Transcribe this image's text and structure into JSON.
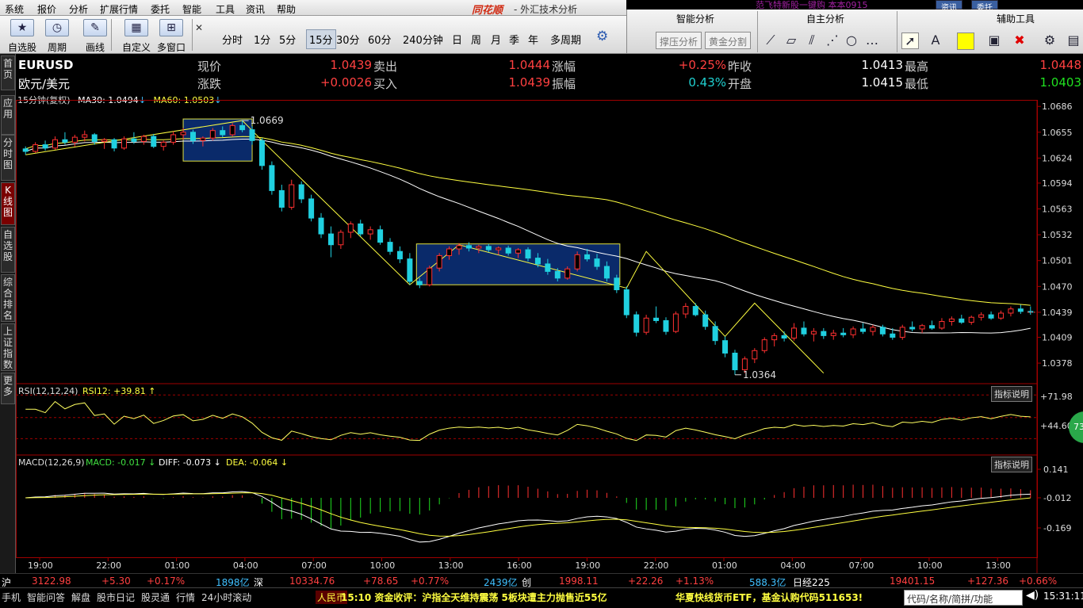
{
  "app": {
    "title": "同花顺",
    "subtitle": "- 外汇技术分析"
  },
  "menu": [
    "系统",
    "报价",
    "分析",
    "扩展行情",
    "委托",
    "智能",
    "工具",
    "资讯",
    "帮助"
  ],
  "topright": {
    "text": "范飞特新股一键购   本本0915",
    "btn1": "资讯",
    "btn2": "委托"
  },
  "toolbar": {
    "items": [
      {
        "label": "自选股",
        "icon": "★"
      },
      {
        "label": "周期",
        "icon": "◷"
      },
      {
        "label": "画线",
        "icon": "✎"
      },
      {
        "label": "自定义",
        "icon": "▦"
      },
      {
        "label": "多窗口",
        "icon": "⊞"
      }
    ],
    "periods": [
      "分时",
      "1分",
      "5分",
      "15分",
      "30分",
      "60分",
      "240分钟",
      "日",
      "周",
      "月",
      "季",
      "年",
      "多周期"
    ],
    "active_period": "15分"
  },
  "panels": {
    "smart": "智能分析",
    "self": "自主分析",
    "aux": "辅助工具",
    "btn_support": "撑压分析",
    "btn_golden": "黄金分割"
  },
  "lefttabs": [
    "首页",
    "应用",
    "分时图",
    "K线图",
    "自选股",
    "综合排名",
    "上证指数",
    "更多"
  ],
  "quote": {
    "symbol": "EURUSD",
    "name": "欧元/美元",
    "l1": [
      [
        "现价",
        "1.0439"
      ],
      [
        "卖出",
        "1.0444"
      ],
      [
        "涨幅",
        "+0.25%"
      ],
      [
        "昨收",
        "1.0413"
      ],
      [
        "最高",
        "1.0448"
      ]
    ],
    "l2": [
      [
        "涨跌",
        "+0.0026"
      ],
      [
        "买入",
        "1.0439"
      ],
      [
        "振幅",
        "0.43%"
      ],
      [
        "开盘",
        "1.0415"
      ],
      [
        "最低",
        "1.0403"
      ]
    ]
  },
  "main": {
    "period": "15分钟(复权)",
    "ma30": "MA30: 1.0494",
    "ma60": "MA60: 1.0503",
    "high_label": "1.0669",
    "low_label": "1.0364",
    "yticks": [
      "1.0686",
      "1.0655",
      "1.0624",
      "1.0594",
      "1.0563",
      "1.0532",
      "1.0501",
      "1.0470",
      "1.0439",
      "1.0409",
      "1.0378"
    ]
  },
  "rsi": {
    "label": "RSI(12,12,24)",
    "value": "RSI12: +39.81",
    "btn": "指标说明",
    "yticks": [
      "+71.98",
      "+44.60"
    ]
  },
  "macd": {
    "label": "MACD(12,26,9)",
    "macd": "MACD: -0.017",
    "diff": "DIFF: -0.073",
    "dea": "DEA: -0.064",
    "btn": "指标说明",
    "yticks": [
      "0.141",
      "-0.012",
      "-0.169"
    ]
  },
  "xticks": [
    "19:00",
    "22:00",
    "01:00",
    "04:00",
    "07:00",
    "10:00",
    "13:00",
    "16:00",
    "19:00",
    "22:00",
    "01:00",
    "04:00",
    "07:00",
    "10:00",
    "13:00"
  ],
  "status": {
    "sh_label": "沪",
    "sh_val": "3122.98",
    "sh_chg": "+5.30",
    "sh_pct": "+0.17%",
    "sh_amt": "1898亿",
    "sz_label": "深",
    "sz_val": "10334.76",
    "sz_chg": "+78.65",
    "sz_pct": "+0.77%",
    "sz_amt": "2439亿",
    "cy_label": "创",
    "cy_val": "1998.11",
    "cy_chg": "+22.26",
    "cy_pct": "+1.13%",
    "cy_amt": "588.3亿",
    "rj_label": "日经225",
    "rj_val": "19401.15",
    "rj_chg": "+127.36",
    "rj_pct": "+0.66%"
  },
  "bottom": {
    "items": [
      "手机",
      "智能问答",
      "解盘",
      "股市日记",
      "股灵通",
      "行情",
      "24小时滚动"
    ],
    "currency": "人民币",
    "news1": "15:10 资金收评：沪指全天维持震荡 5板块遭主力抛售近55亿",
    "news2": "华夏快线货币ETF，基金认购代码511653!",
    "search": "代码/名称/简拼/功能",
    "time": "15:31:11"
  },
  "badge": "73",
  "chart_data": {
    "type": "candlestick",
    "symbol": "EURUSD",
    "interval": "15min",
    "ylim": [
      1.036,
      1.069
    ],
    "candles": [
      [
        1.0635,
        1.0638,
        1.0628,
        1.0632
      ],
      [
        1.0632,
        1.0643,
        1.063,
        1.064
      ],
      [
        1.064,
        1.0645,
        1.0633,
        1.0636
      ],
      [
        1.0636,
        1.065,
        1.0634,
        1.0646
      ],
      [
        1.0646,
        1.0655,
        1.064,
        1.0643
      ],
      [
        1.0643,
        1.0652,
        1.0638,
        1.0649
      ],
      [
        1.0649,
        1.0657,
        1.0644,
        1.0652
      ],
      [
        1.0652,
        1.0654,
        1.064,
        1.0644
      ],
      [
        1.0644,
        1.0648,
        1.0635,
        1.0646
      ],
      [
        1.0646,
        1.0648,
        1.0632,
        1.0636
      ],
      [
        1.0636,
        1.065,
        1.0634,
        1.0647
      ],
      [
        1.0647,
        1.0655,
        1.0641,
        1.0644
      ],
      [
        1.0644,
        1.0652,
        1.064,
        1.065
      ],
      [
        1.065,
        1.0653,
        1.0636,
        1.0638
      ],
      [
        1.0638,
        1.0645,
        1.0633,
        1.0643
      ],
      [
        1.0643,
        1.0656,
        1.064,
        1.0652
      ],
      [
        1.0652,
        1.066,
        1.0646,
        1.0655
      ],
      [
        1.0655,
        1.0658,
        1.0641,
        1.0645
      ],
      [
        1.0645,
        1.065,
        1.0638,
        1.0648
      ],
      [
        1.0648,
        1.066,
        1.0645,
        1.0657
      ],
      [
        1.0657,
        1.0662,
        1.0649,
        1.0652
      ],
      [
        1.0652,
        1.0666,
        1.065,
        1.0663
      ],
      [
        1.0663,
        1.0669,
        1.0655,
        1.0658
      ],
      [
        1.0658,
        1.0662,
        1.064,
        1.0645
      ],
      [
        1.0645,
        1.0648,
        1.061,
        1.0615
      ],
      [
        1.0615,
        1.062,
        1.058,
        1.0585
      ],
      [
        1.0585,
        1.0592,
        1.056,
        1.0565
      ],
      [
        1.0565,
        1.0598,
        1.0562,
        1.0592
      ],
      [
        1.0592,
        1.0596,
        1.057,
        1.0575
      ],
      [
        1.0575,
        1.058,
        1.0548,
        1.0552
      ],
      [
        1.0552,
        1.0558,
        1.0528,
        1.0533
      ],
      [
        1.0533,
        1.0542,
        1.0505,
        1.052
      ],
      [
        1.052,
        1.0538,
        1.0515,
        1.0535
      ],
      [
        1.0535,
        1.0548,
        1.0528,
        1.0545
      ],
      [
        1.0545,
        1.055,
        1.053,
        1.0533
      ],
      [
        1.0533,
        1.0542,
        1.0526,
        1.0538
      ],
      [
        1.0538,
        1.0543,
        1.052,
        1.0523
      ],
      [
        1.0523,
        1.0528,
        1.0508,
        1.0512
      ],
      [
        1.0512,
        1.0518,
        1.0498,
        1.0503
      ],
      [
        1.0503,
        1.051,
        1.0472,
        1.0476
      ],
      [
        1.0476,
        1.048,
        1.0468,
        1.0472
      ],
      [
        1.0472,
        1.0495,
        1.047,
        1.0492
      ],
      [
        1.0492,
        1.051,
        1.0488,
        1.0507
      ],
      [
        1.0507,
        1.0518,
        1.0502,
        1.0515
      ],
      [
        1.0515,
        1.0522,
        1.0508,
        1.0519
      ],
      [
        1.0519,
        1.0523,
        1.0512,
        1.0516
      ],
      [
        1.0516,
        1.052,
        1.051,
        1.0518
      ],
      [
        1.0518,
        1.0521,
        1.0511,
        1.0514
      ],
      [
        1.0514,
        1.0518,
        1.0508,
        1.0516
      ],
      [
        1.0516,
        1.0519,
        1.0507,
        1.051
      ],
      [
        1.051,
        1.0516,
        1.0504,
        1.0514
      ],
      [
        1.0514,
        1.0517,
        1.05,
        1.0504
      ],
      [
        1.0504,
        1.051,
        1.0493,
        1.0497
      ],
      [
        1.0497,
        1.0503,
        1.0484,
        1.0488
      ],
      [
        1.0488,
        1.0492,
        1.0476,
        1.048
      ],
      [
        1.048,
        1.0494,
        1.0478,
        1.0491
      ],
      [
        1.0491,
        1.0512,
        1.0488,
        1.0508
      ],
      [
        1.0508,
        1.0515,
        1.05,
        1.0503
      ],
      [
        1.0503,
        1.0509,
        1.049,
        1.0494
      ],
      [
        1.0494,
        1.05,
        1.0476,
        1.048
      ],
      [
        1.048,
        1.0484,
        1.0462,
        1.0466
      ],
      [
        1.0466,
        1.047,
        1.0432,
        1.0436
      ],
      [
        1.0436,
        1.044,
        1.041,
        1.0415
      ],
      [
        1.0415,
        1.0436,
        1.0412,
        1.0432
      ],
      [
        1.0432,
        1.0446,
        1.0426,
        1.0429
      ],
      [
        1.0429,
        1.0433,
        1.0412,
        1.0416
      ],
      [
        1.0416,
        1.044,
        1.0414,
        1.0437
      ],
      [
        1.0437,
        1.045,
        1.0432,
        1.0446
      ],
      [
        1.0446,
        1.045,
        1.0434,
        1.0436
      ],
      [
        1.0436,
        1.0441,
        1.0418,
        1.0422
      ],
      [
        1.0422,
        1.0428,
        1.04,
        1.0405
      ],
      [
        1.0405,
        1.041,
        1.0385,
        1.039
      ],
      [
        1.039,
        1.0394,
        1.0364,
        1.037
      ],
      [
        1.037,
        1.0386,
        1.0366,
        1.0383
      ],
      [
        1.0383,
        1.0396,
        1.0378,
        1.0393
      ],
      [
        1.0393,
        1.0409,
        1.039,
        1.0406
      ],
      [
        1.0406,
        1.0414,
        1.0398,
        1.0411
      ],
      [
        1.0411,
        1.0416,
        1.0404,
        1.0408
      ],
      [
        1.0408,
        1.0426,
        1.0405,
        1.042
      ],
      [
        1.042,
        1.0428,
        1.041,
        1.0413
      ],
      [
        1.0413,
        1.042,
        1.0404,
        1.0416
      ],
      [
        1.0416,
        1.042,
        1.0407,
        1.0411
      ],
      [
        1.0411,
        1.0418,
        1.0406,
        1.0414
      ],
      [
        1.0414,
        1.042,
        1.0409,
        1.0412
      ],
      [
        1.0412,
        1.0422,
        1.0408,
        1.0419
      ],
      [
        1.0419,
        1.0426,
        1.0413,
        1.0416
      ],
      [
        1.0416,
        1.0424,
        1.0411,
        1.0421
      ],
      [
        1.0421,
        1.0424,
        1.041,
        1.0413
      ],
      [
        1.0413,
        1.042,
        1.0406,
        1.0409
      ],
      [
        1.0409,
        1.0424,
        1.0406,
        1.0421
      ],
      [
        1.0421,
        1.0428,
        1.0416,
        1.0419
      ],
      [
        1.0419,
        1.0425,
        1.0414,
        1.0423
      ],
      [
        1.0423,
        1.0429,
        1.0418,
        1.042
      ],
      [
        1.042,
        1.0432,
        1.0418,
        1.0428
      ],
      [
        1.0428,
        1.0434,
        1.0423,
        1.0431
      ],
      [
        1.0431,
        1.0436,
        1.0425,
        1.0427
      ],
      [
        1.0427,
        1.0435,
        1.0424,
        1.0433
      ],
      [
        1.0433,
        1.0439,
        1.0429,
        1.0436
      ],
      [
        1.0436,
        1.044,
        1.043,
        1.0432
      ],
      [
        1.0432,
        1.0441,
        1.043,
        1.0438
      ],
      [
        1.0438,
        1.0446,
        1.0434,
        1.0443
      ],
      [
        1.0443,
        1.0448,
        1.0437,
        1.044
      ],
      [
        1.044,
        1.0446,
        1.0436,
        1.0439
      ]
    ]
  }
}
